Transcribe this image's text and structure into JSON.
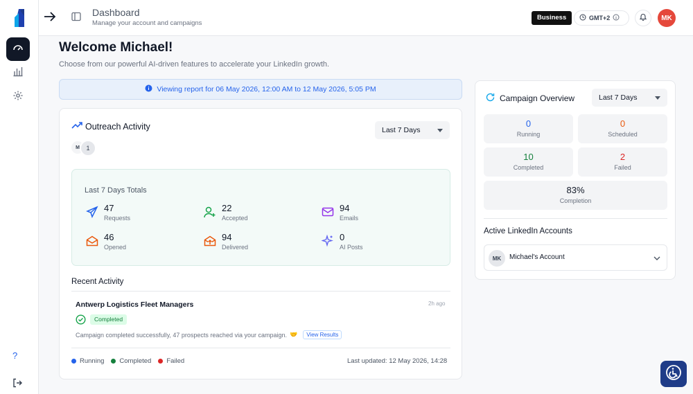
{
  "header": {
    "title": "Dashboard",
    "subtitle": "Manage your account and campaigns",
    "plan_badge": "Business",
    "timezone": "GMT+2",
    "avatar_initials": "MK"
  },
  "sidebar": {
    "help_label": "?",
    "items": [
      "dashboard",
      "analytics",
      "settings"
    ]
  },
  "welcome": {
    "title": "Welcome Michael!",
    "subtitle": "Choose from our powerful AI-driven features to accelerate your LinkedIn growth."
  },
  "report_banner": "Viewing report for 06 May 2026, 12:00 AM to 12 May 2026, 5:05 PM",
  "outreach": {
    "title": "Outreach Activity",
    "range": "Last 7 Days",
    "account_chip": "M",
    "account_count": "1",
    "totals_title": "Last 7 Days Totals",
    "stats": [
      {
        "value": "47",
        "label": "Requests",
        "icon": "send-icon",
        "color": "#2563eb"
      },
      {
        "value": "22",
        "label": "Accepted",
        "icon": "user-plus-icon",
        "color": "#16a34a"
      },
      {
        "value": "94",
        "label": "Emails",
        "icon": "mail-icon",
        "color": "#9333ea"
      },
      {
        "value": "46",
        "label": "Opened",
        "icon": "mail-open-icon",
        "color": "#ea580c"
      },
      {
        "value": "94",
        "label": "Delivered",
        "icon": "mail-delivered-icon",
        "color": "#ea580c"
      },
      {
        "value": "0",
        "label": "AI Posts",
        "icon": "sparkles-icon",
        "color": "#6366f1"
      }
    ],
    "recent_title": "Recent Activity",
    "recent": {
      "name": "Antwerp Logistics Fleet Managers",
      "time": "2h ago",
      "status": "Completed",
      "message": "Campaign completed successfully, 47 prospects reached via your campaign.",
      "emoji": "🤝",
      "action": "View Results"
    },
    "legend": [
      {
        "label": "Running",
        "color": "#2563eb"
      },
      {
        "label": "Completed",
        "color": "#15803d"
      },
      {
        "label": "Failed",
        "color": "#dc2626"
      }
    ],
    "last_updated": "Last updated: 12 May 2026, 14:28"
  },
  "campaign": {
    "title": "Campaign Overview",
    "range": "Last 7 Days",
    "tiles": [
      {
        "value": "0",
        "label": "Running",
        "color": "#2563eb"
      },
      {
        "value": "0",
        "label": "Scheduled",
        "color": "#ea580c"
      },
      {
        "value": "10",
        "label": "Completed",
        "color": "#15803d"
      },
      {
        "value": "2",
        "label": "Failed",
        "color": "#dc2626"
      }
    ],
    "completion_value": "83%",
    "completion_label": "Completion",
    "accounts_title": "Active LinkedIn Accounts",
    "account_initials": "MK",
    "account_name": "Michael's Account"
  }
}
